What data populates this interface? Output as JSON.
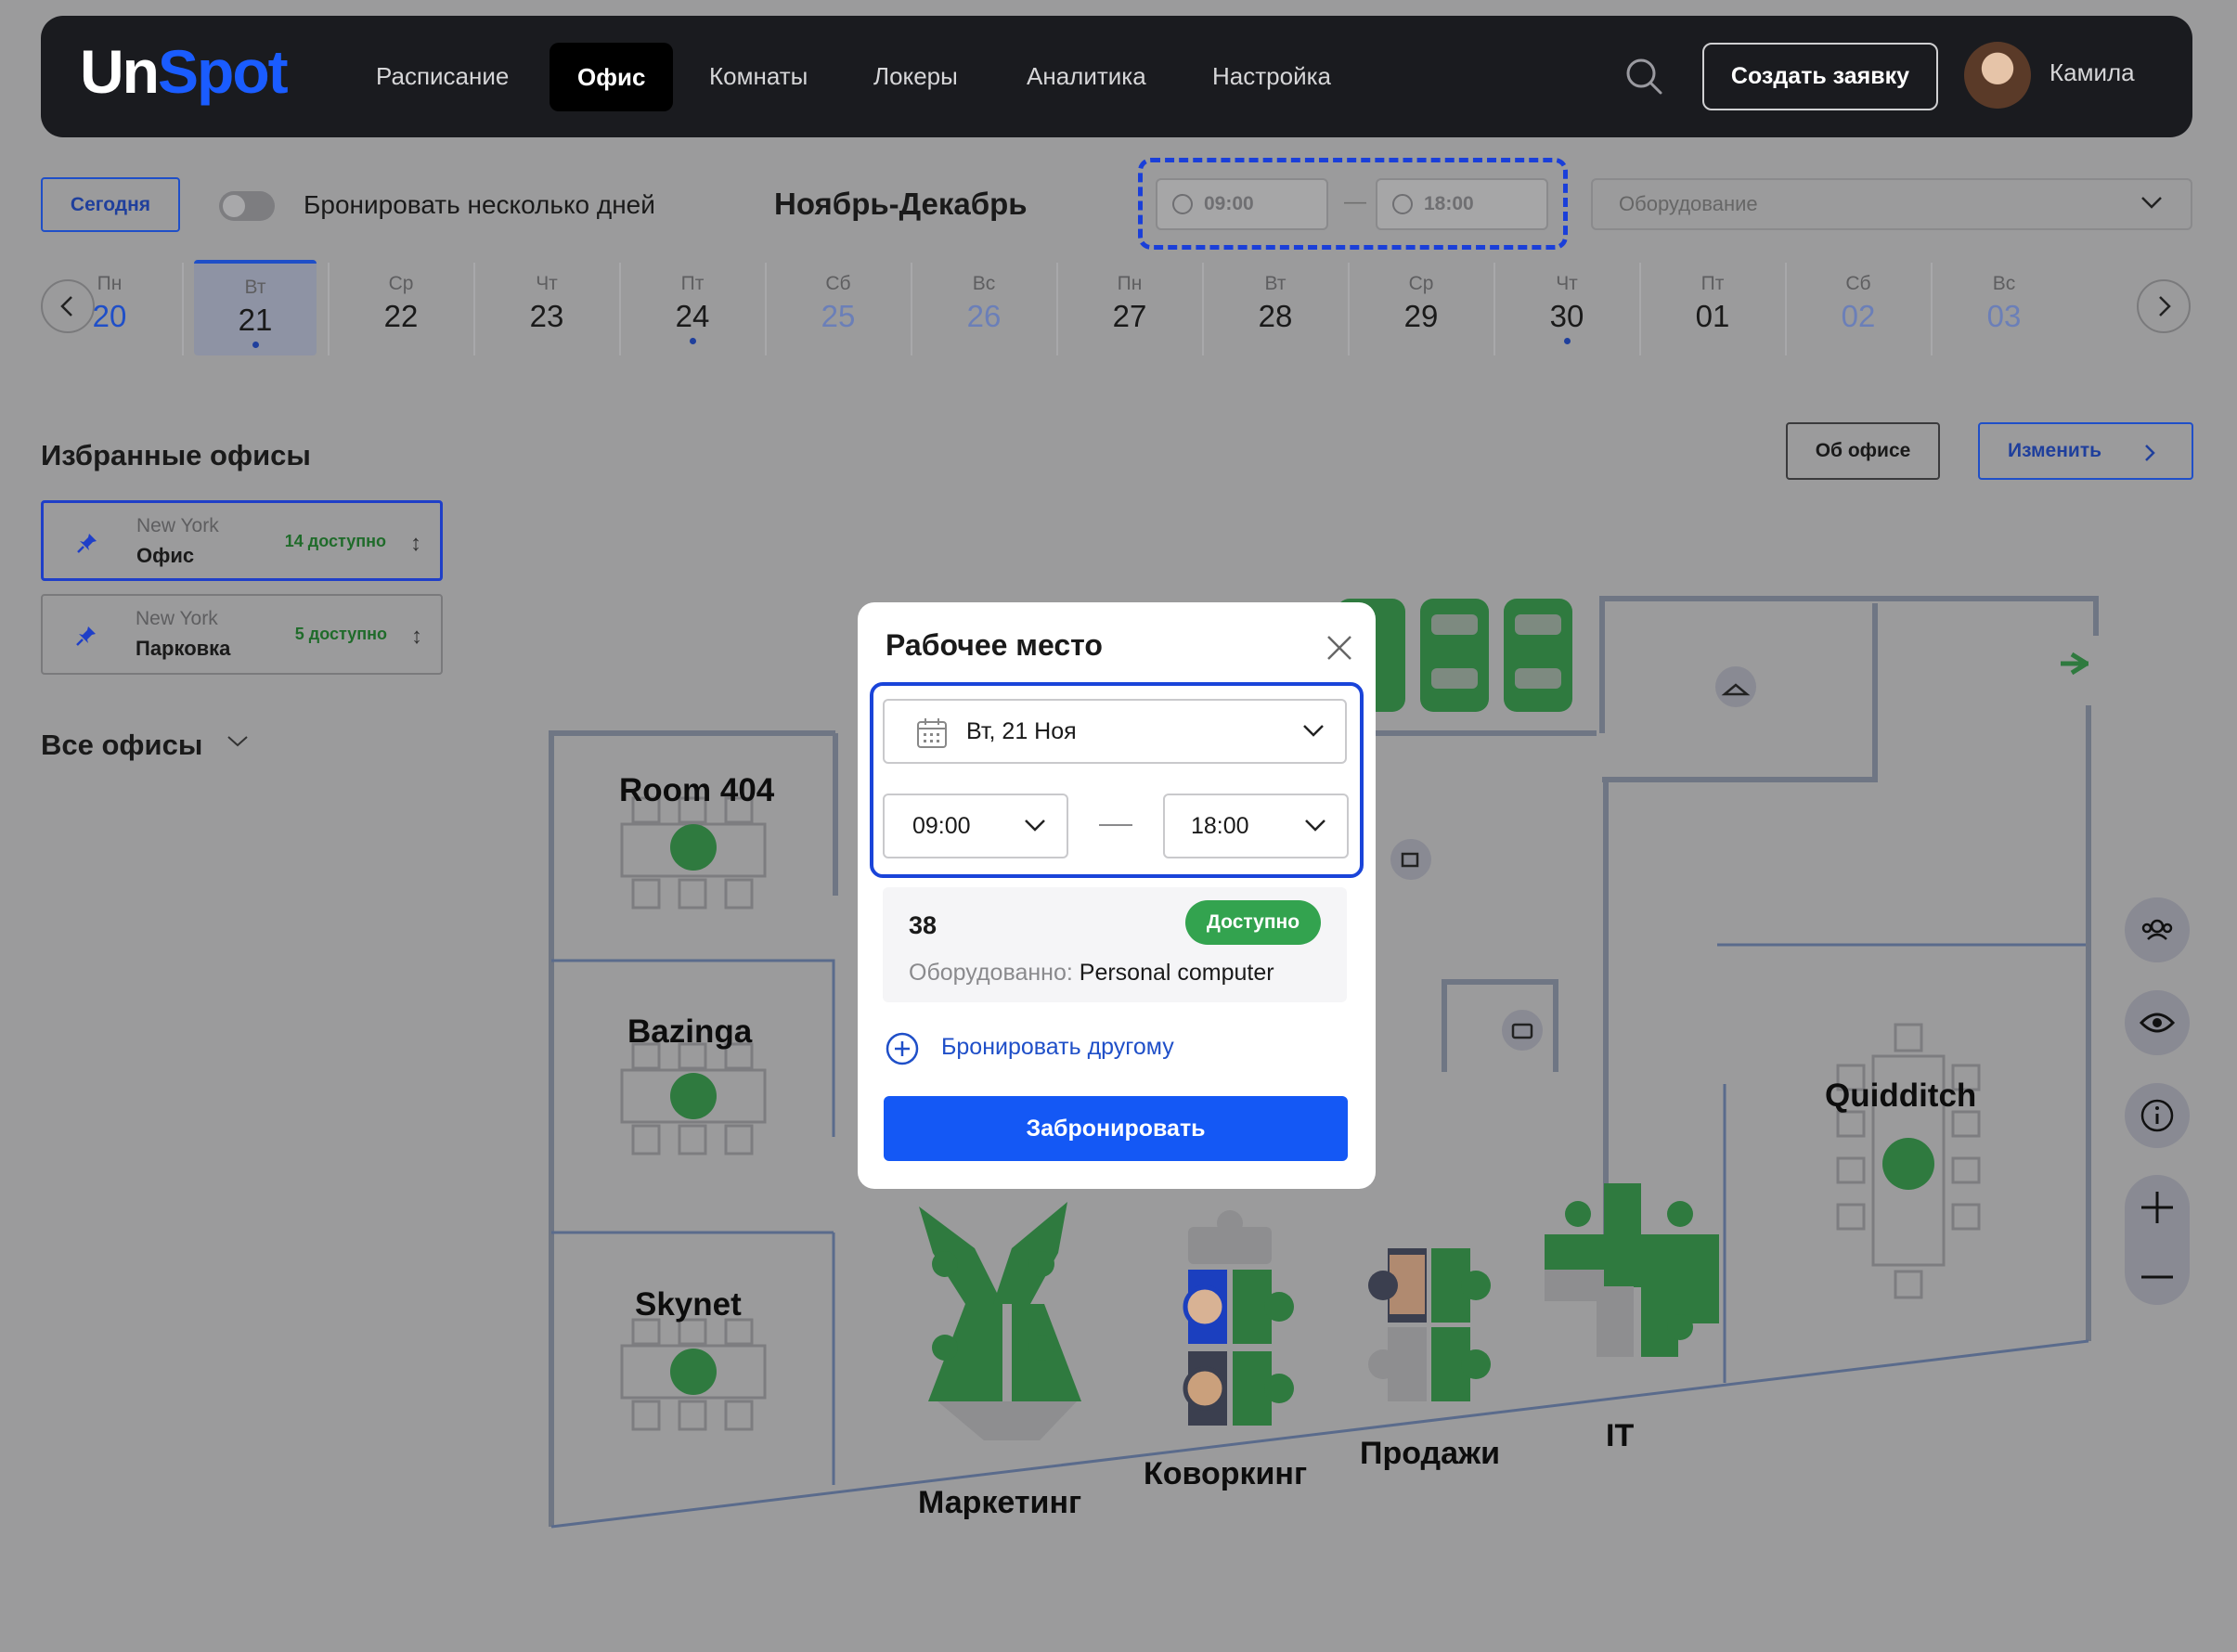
{
  "app": {
    "logo_main": "Un",
    "logo_accent": "Spot",
    "nav": [
      "Расписание",
      "Офис",
      "Комнаты",
      "Локеры",
      "Аналитика",
      "Настройка"
    ],
    "active_nav": "Офис",
    "create_button": "Создать заявку",
    "user_name": "Камила"
  },
  "filters": {
    "today_button": "Сегодня",
    "multi_day_label": "Бронировать несколько дней",
    "multi_day_enabled": false,
    "month_label": "Ноябрь-Декабрь",
    "time_from": "09:00",
    "time_to": "18:00",
    "time_separator": "—",
    "equipment_placeholder": "Оборудование"
  },
  "days": [
    {
      "wd": "Пн",
      "num": "20",
      "style": "blue",
      "dot": false
    },
    {
      "wd": "Вт",
      "num": "21",
      "style": "selected",
      "dot": true
    },
    {
      "wd": "Ср",
      "num": "22",
      "style": "normal",
      "dot": false
    },
    {
      "wd": "Чт",
      "num": "23",
      "style": "normal",
      "dot": false
    },
    {
      "wd": "Пт",
      "num": "24",
      "style": "normal",
      "dot": true
    },
    {
      "wd": "Сб",
      "num": "25",
      "style": "weekend",
      "dot": false
    },
    {
      "wd": "Вс",
      "num": "26",
      "style": "weekend",
      "dot": false
    },
    {
      "wd": "Пн",
      "num": "27",
      "style": "normal",
      "dot": false
    },
    {
      "wd": "Вт",
      "num": "28",
      "style": "normal",
      "dot": false
    },
    {
      "wd": "Ср",
      "num": "29",
      "style": "normal",
      "dot": false
    },
    {
      "wd": "Чт",
      "num": "30",
      "style": "normal",
      "dot": true
    },
    {
      "wd": "Пт",
      "num": "01",
      "style": "normal",
      "dot": false
    },
    {
      "wd": "Сб",
      "num": "02",
      "style": "weekend",
      "dot": false
    },
    {
      "wd": "Вс",
      "num": "03",
      "style": "weekend",
      "dot": false
    }
  ],
  "sidebar": {
    "favorites_title": "Избранные офисы",
    "favorites": [
      {
        "city": "New York",
        "name": "Офис",
        "available": "14 доступно"
      },
      {
        "city": "New York",
        "name": "Парковка",
        "available": "5 доступно"
      }
    ],
    "all_offices_title": "Все офисы"
  },
  "office_actions": {
    "about": "Об офисе",
    "change": "Изменить"
  },
  "map": {
    "rooms": [
      "Room 404",
      "Bazinga",
      "Skynet",
      "Quidditch"
    ],
    "zones": [
      "Маркетинг",
      "Коворкинг",
      "Продажи",
      "IT"
    ]
  },
  "modal": {
    "title": "Рабочее место",
    "date": "Вт, 21 Ноя",
    "time_from": "09:00",
    "time_to": "18:00",
    "seat_number": "38",
    "status": "Доступно",
    "equipment_key": "Оборудованно:",
    "equipment_value": "Personal computer",
    "book_other": "Бронировать другому",
    "book_button": "Забронировать"
  },
  "colors": {
    "accent": "#1458f5",
    "available": "#33a34f",
    "desk_green": "#2f7a3f",
    "nav_bg": "#1a1b1f"
  }
}
